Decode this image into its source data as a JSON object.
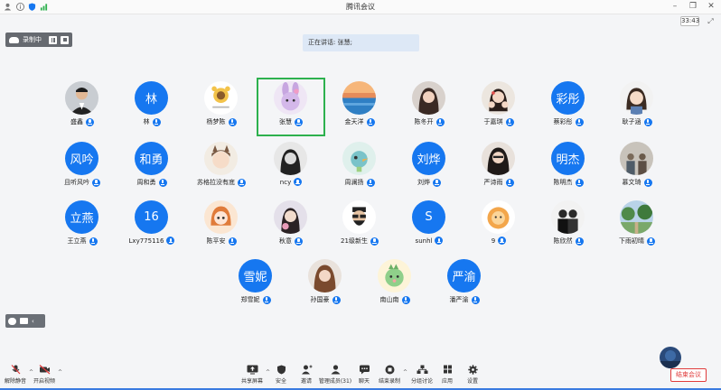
{
  "window": {
    "title": "腾讯会议",
    "timer": "33:43"
  },
  "recording": {
    "label": "录制中"
  },
  "speaking": {
    "text": "正在讲话: 张慧;"
  },
  "participants": [
    {
      "name": "盛鑫",
      "avatar": "photo-man-suit"
    },
    {
      "name": "林",
      "avatar_text": "林"
    },
    {
      "name": "杨梦陈",
      "avatar": "sunflower-cartoon"
    },
    {
      "name": "张慧",
      "avatar": "stellalou-bunny"
    },
    {
      "name": "金天洋",
      "avatar": "sea-sunset"
    },
    {
      "name": "陈冬开",
      "avatar": "girl-photo"
    },
    {
      "name": "于嘉琪",
      "avatar": "girl-hands"
    },
    {
      "name": "蔡彩彤",
      "avatar_text": "彩彤"
    },
    {
      "name": "耿子涵",
      "avatar": "cartoon-girl"
    },
    {
      "name": "且听风吟",
      "avatar_text": "风吟"
    },
    {
      "name": "周和勇",
      "avatar_text": "和勇"
    },
    {
      "name": "苏格拉没有底",
      "avatar": "cartoon-cat-girl"
    },
    {
      "name": "ncy",
      "avatar": "girl-bw"
    },
    {
      "name": "周澜扬",
      "avatar": "blue-bird"
    },
    {
      "name": "刘烨",
      "avatar_text": "刘烨"
    },
    {
      "name": "严诗雨",
      "avatar": "girl-selfie"
    },
    {
      "name": "陈明杰",
      "avatar_text": "明杰"
    },
    {
      "name": "慕文琦",
      "avatar": "people-group"
    },
    {
      "name": "王立燕",
      "avatar_text": "立燕"
    },
    {
      "name": "Lxy775116",
      "avatar_text": "16"
    },
    {
      "name": "陈平安",
      "avatar": "anime-orange"
    },
    {
      "name": "秋意",
      "avatar": "girl-flower"
    },
    {
      "name": "21级新生",
      "avatar": "bearded-glasses"
    },
    {
      "name": "sunhl",
      "avatar_text": "S"
    },
    {
      "name": "9",
      "avatar": "cute-lion"
    },
    {
      "name": "陈欣然",
      "avatar": "couple-dark"
    },
    {
      "name": "下雨初晴",
      "avatar": "park-trees"
    },
    {
      "name": "郑雪妮",
      "avatar_text": "雪妮"
    },
    {
      "name": "孙国豪",
      "avatar": "brown-hair-girl"
    },
    {
      "name": "南山南",
      "avatar": "green-dino"
    },
    {
      "name": "潘严渝",
      "avatar_text": "严渝"
    }
  ],
  "toolbar": {
    "mute": "解除静音",
    "video": "开启视频",
    "share": "共享屏幕",
    "security": "安全",
    "invite": "邀请",
    "members": "管理成员(31)",
    "chat": "聊天",
    "record": "结束录制",
    "breakout": "分组讨论",
    "apps": "应用",
    "settings": "设置",
    "end": "结束会议"
  },
  "colors": {
    "accent": "#1677f0",
    "speaking_frame": "#2db14e",
    "end": "#e03b3b"
  }
}
